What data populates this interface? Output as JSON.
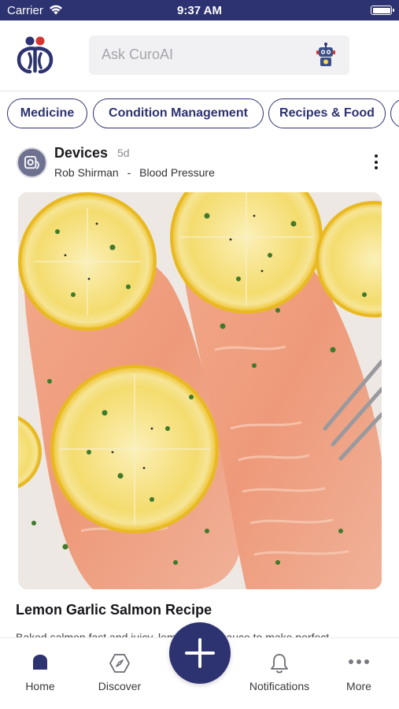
{
  "status_bar": {
    "carrier": "Carrier",
    "time": "9:37 AM"
  },
  "header": {
    "search_placeholder": "Ask CuroAI"
  },
  "chips": [
    {
      "label": "Medicine"
    },
    {
      "label": "Condition Management"
    },
    {
      "label": "Recipes & Food"
    }
  ],
  "post": {
    "title": "Devices",
    "age": "5d",
    "author": "Rob Shirman",
    "separator": "-",
    "topic": "Blood Pressure",
    "caption": "Lemon Garlic Salmon Recipe",
    "excerpt": "Baked salmon fast and juicy, lemon garlic sauce to make perfect"
  },
  "tab_bar": {
    "home": "Home",
    "discover": "Discover",
    "notifications": "Notifications",
    "more": "More"
  },
  "colors": {
    "brand": "#2d3270",
    "accent_red": "#d8342e"
  }
}
